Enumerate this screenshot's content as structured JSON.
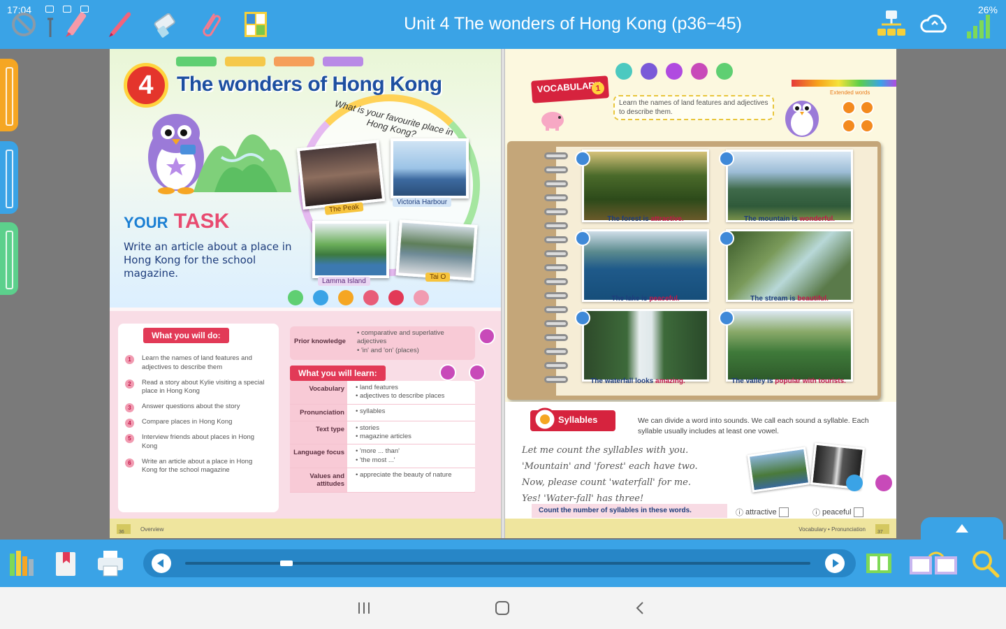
{
  "status": {
    "time": "17:04",
    "battery": "26%"
  },
  "toolbar": {
    "title": "Unit 4 The wonders of Hong Kong (p36−45)",
    "tools": [
      "no-entry-icon",
      "pointer-icon",
      "highlighter-icon",
      "pen-icon",
      "eraser-icon",
      "paperclip-icon",
      "grid-icon"
    ],
    "right_tools": [
      "network-icon",
      "cloud-sync-icon",
      "signal-icon"
    ]
  },
  "left_page": {
    "unit_number": "4",
    "title": "The wonders of Hong Kong",
    "arc_question": "What is your favourite place in Hong Kong?",
    "photos": [
      {
        "label": "The Peak"
      },
      {
        "label": "Victoria Harbour"
      },
      {
        "label": "Lamma Island"
      },
      {
        "label": "Tai O"
      }
    ],
    "task": {
      "heading_your": "YOUR",
      "heading_task": "TASK",
      "body": "Write an article about a place in Hong Kong for the school magazine."
    },
    "what_you_will_do": {
      "title": "What you will do:",
      "items": [
        "Learn the names of land features and adjectives to describe them",
        "Read a story about Kylie visiting a special place in Hong Kong",
        "Answer questions about the story",
        "Compare places in Hong Kong",
        "Interview friends about places in Hong Kong",
        "Write an article about a place in Hong Kong for the school magazine"
      ]
    },
    "prior_knowledge": {
      "label": "Prior knowledge",
      "items": [
        "comparative and superlative adjectives",
        "'in' and 'on' (places)"
      ]
    },
    "what_you_will_learn": {
      "title": "What you will learn:",
      "rows": [
        {
          "key": "Vocabulary",
          "values": [
            "land features",
            "adjectives to describe places"
          ]
        },
        {
          "key": "Pronunciation",
          "values": [
            "syllables"
          ]
        },
        {
          "key": "Text type",
          "values": [
            "stories",
            "magazine articles"
          ]
        },
        {
          "key": "Language focus",
          "values": [
            "'more ... than'",
            "'the most ...'"
          ]
        },
        {
          "key": "Values and attitudes",
          "values": [
            "appreciate the beauty of nature"
          ]
        }
      ]
    },
    "footer": {
      "page": "36",
      "section": "Overview"
    }
  },
  "right_page": {
    "vocab": {
      "label": "VOCABULARY",
      "step": "1"
    },
    "objective": "Learn the names of land features and adjectives to describe them.",
    "extended_words": "Extended words",
    "cards": [
      {
        "noun": "The forest",
        "verb": "is",
        "adj": "attractive."
      },
      {
        "noun": "The mountain",
        "verb": "is",
        "adj": "wonderful."
      },
      {
        "noun": "The lake",
        "verb": "is",
        "adj": "peaceful."
      },
      {
        "noun": "The stream",
        "verb": "is",
        "adj": "beautiful."
      },
      {
        "noun": "The waterfall",
        "verb": "looks",
        "adj": "amazing."
      },
      {
        "noun": "The valley",
        "verb": "is",
        "adj": "popular with tourists."
      }
    ],
    "syllables": {
      "label": "Syllables",
      "desc": "We can divide a word into sounds. We call each sound a syllable. Each syllable usually includes at least one vowel.",
      "poem": [
        "Let me count the syllables with you.",
        "'Mountain' and 'forest' each have two.",
        "Now, please count 'waterfall' for me.",
        "Yes! 'Water-fall' has three!"
      ],
      "instruction": "Count the number of syllables in these words.",
      "options": [
        "attractive",
        "peaceful"
      ]
    },
    "footer": {
      "page": "37",
      "section": "Vocabulary • Pronunciation"
    }
  },
  "bottombar": {
    "tools_left": [
      "bookshelf-icon",
      "bookmark-icon",
      "print-icon"
    ],
    "tools_right": [
      "single-page-icon",
      "double-page-icon",
      "search-icon"
    ],
    "progress": 0.155
  }
}
